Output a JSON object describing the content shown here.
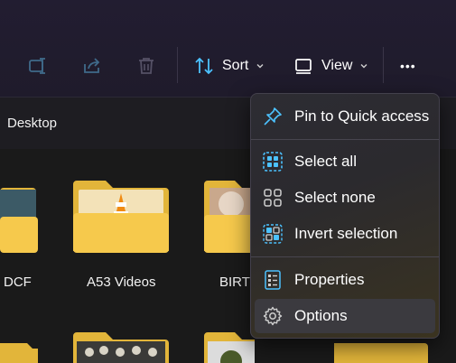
{
  "toolbar": {
    "sort_label": "Sort",
    "view_label": "View",
    "more_label": "•••"
  },
  "address": {
    "location": "Desktop"
  },
  "folders": [
    {
      "label": "DCF"
    },
    {
      "label": "A53 Videos"
    },
    {
      "label": "BIRTH"
    }
  ],
  "menu": {
    "items": [
      {
        "label": "Pin to Quick access",
        "icon": "pin-icon"
      },
      {
        "label": "Select all",
        "icon": "select-all-icon"
      },
      {
        "label": "Select none",
        "icon": "select-none-icon"
      },
      {
        "label": "Invert selection",
        "icon": "invert-selection-icon"
      },
      {
        "label": "Properties",
        "icon": "properties-icon"
      },
      {
        "label": "Options",
        "icon": "options-gear-icon"
      }
    ]
  },
  "colors": {
    "accent": "#4cc2ff",
    "folder": "#f5c842",
    "toolbar_bg": "#221d31",
    "menu_bg": "#2c2b30"
  }
}
